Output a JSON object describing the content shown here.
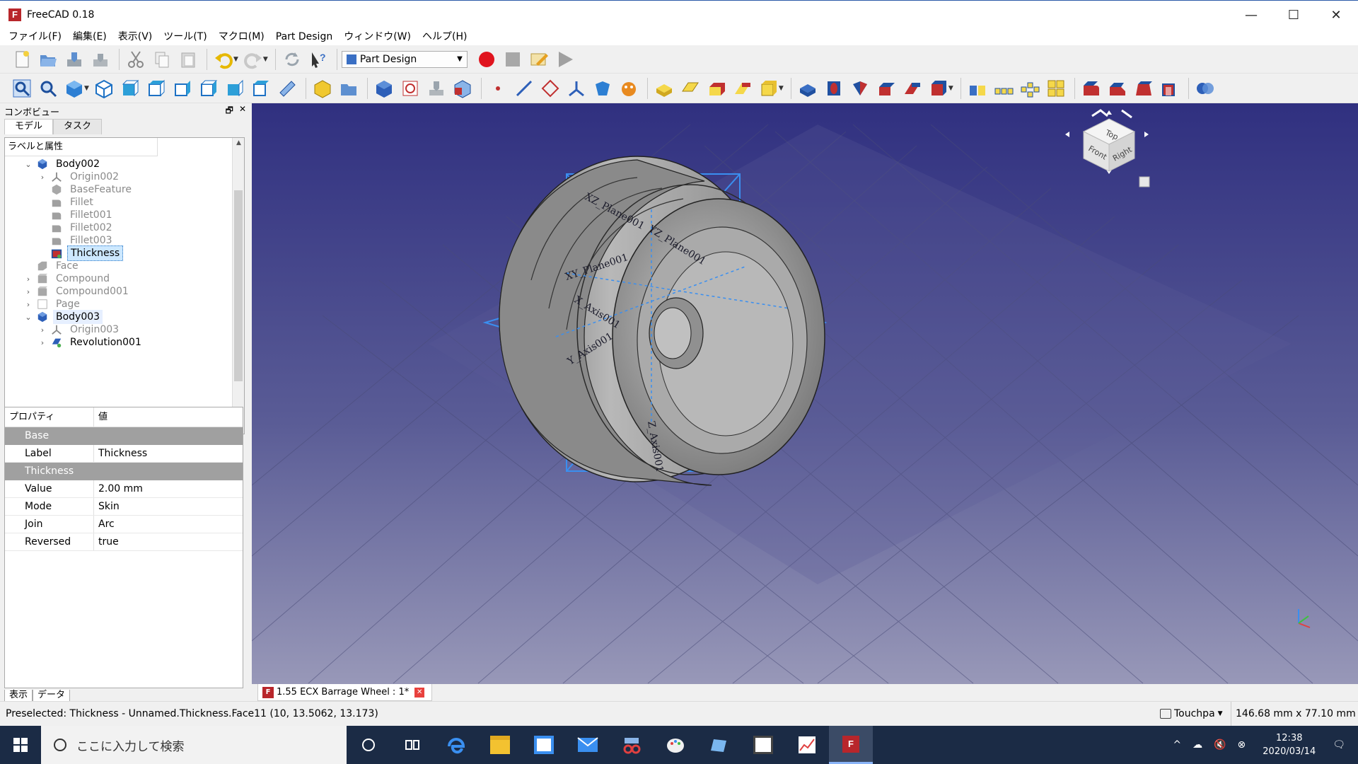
{
  "window": {
    "title": "FreeCAD 0.18",
    "minimize": "—",
    "maximize": "☐",
    "close": "✕"
  },
  "menu": [
    "ファイル(F)",
    "編集(E)",
    "表示(V)",
    "ツール(T)",
    "マクロ(M)",
    "Part Design",
    "ウィンドウ(W)",
    "ヘルプ(H)"
  ],
  "workbench": {
    "selected": "Part Design"
  },
  "combo": {
    "title": "コンボビュー",
    "float_btn": "🗗",
    "close_btn": "✕",
    "tabs": [
      "モデル",
      "タスク"
    ],
    "tree_header": "ラベルと属性",
    "tree": [
      {
        "label": "Body002",
        "expander": "⌄",
        "icon": "body-icon"
      },
      {
        "label": "Origin002",
        "expander": "›",
        "icon": "origin-icon"
      },
      {
        "label": "BaseFeature",
        "expander": "",
        "icon": "feature-icon"
      },
      {
        "label": "Fillet",
        "expander": "",
        "icon": "fillet-icon"
      },
      {
        "label": "Fillet001",
        "expander": "",
        "icon": "fillet-icon"
      },
      {
        "label": "Fillet002",
        "expander": "",
        "icon": "fillet-icon"
      },
      {
        "label": "Fillet003",
        "expander": "",
        "icon": "fillet-icon"
      },
      {
        "label": "Thickness",
        "expander": "",
        "icon": "thickness-icon"
      },
      {
        "label": "Face",
        "expander": "",
        "icon": "face-icon"
      },
      {
        "label": "Compound",
        "expander": "›",
        "icon": "compound-icon"
      },
      {
        "label": "Compound001",
        "expander": "›",
        "icon": "compound-icon"
      },
      {
        "label": "Page",
        "expander": "›",
        "icon": "page-icon"
      },
      {
        "label": "Body003",
        "expander": "⌄",
        "icon": "body-icon"
      },
      {
        "label": "Origin003",
        "expander": "›",
        "icon": "origin-icon"
      },
      {
        "label": "Revolution001",
        "expander": "›",
        "icon": "revolution-icon"
      }
    ],
    "props_header": {
      "property": "プロパティ",
      "value": "値"
    },
    "props": {
      "group_base": "Base",
      "label_key": "Label",
      "label_val": "Thickness",
      "group_thickness": "Thickness",
      "value_key": "Value",
      "value_val": "2.00 mm",
      "mode_key": "Mode",
      "mode_val": "Skin",
      "join_key": "Join",
      "join_val": "Arc",
      "reversed_key": "Reversed",
      "reversed_val": "true"
    },
    "bottom_tabs": [
      "表示",
      "データ"
    ]
  },
  "viewport": {
    "background_top": "#303080",
    "background_bottom": "#9898b8",
    "datum_labels": [
      "XZ_Plane001",
      "XY_Plane001",
      "YZ_Plane001",
      "X_Axis001",
      "Y_Axis001",
      "Z_Axis001"
    ],
    "navcube": {
      "top": "Top",
      "front": "Front",
      "right": "Right"
    }
  },
  "document_tab": {
    "label": "1.55 ECX Barrage Wheel : 1*"
  },
  "status": {
    "text": "Preselected: Thickness - Unnamed.Thickness.Face11 (10, 13.5062, 13.173)",
    "nav_style": "Touchpa",
    "dimensions": "146.68 mm x 77.10 mm"
  },
  "taskbar": {
    "search_placeholder": "ここに入力して検索",
    "time": "12:38",
    "date": "2020/03/14",
    "tray_up": "^",
    "tray_volume": "🔇"
  },
  "colors": {
    "accent": "#1d71c4",
    "record": "#e0141e",
    "freecad_red": "#b8262b",
    "taskbar": "#1b2b45"
  }
}
